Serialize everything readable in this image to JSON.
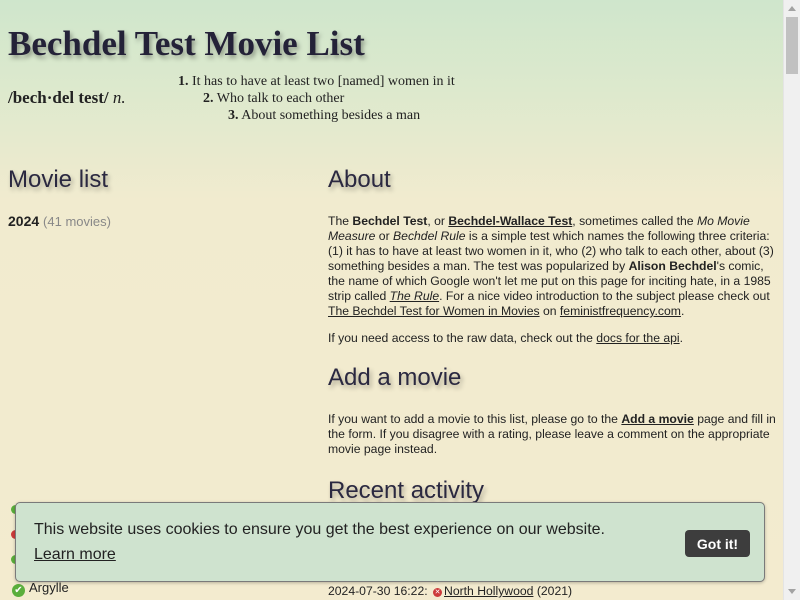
{
  "header": {
    "title": "Bechdel Test Movie List",
    "pronunciation": "/bech·del test/",
    "pos": "n.",
    "criteria": [
      {
        "num": "1.",
        "text": "It has to have at least two [named] women in it"
      },
      {
        "num": "2.",
        "text": "Who talk to each other"
      },
      {
        "num": "3.",
        "text": "About something besides a man"
      }
    ]
  },
  "movie_list": {
    "heading": "Movie list",
    "year": "2024",
    "count": "(41 movies)",
    "visible_item": "Argylle"
  },
  "about": {
    "heading": "About",
    "p1": {
      "t1": "The ",
      "b1": "Bechdel Test",
      "t2": ", or ",
      "link1": "Bechdel-Wallace Test",
      "t3": ", sometimes called the ",
      "i1": "Mo Movie Measure",
      "t4": " or ",
      "i2": "Bechdel Rule",
      "t5": " is a simple test which names the following three criteria: (1) it has to have at least two women in it, who (2) who talk to each other, about (3) something besides a man. The test was popularized by ",
      "b2": "Alison Bechdel",
      "t6": "'s comic, the name of which Google won't let me put on this page for inciting hate, in a 1985 strip called ",
      "link2": "The Rule",
      "t7": ". For a nice video introduction to the subject please check out ",
      "link3": "The Bechdel Test for Women in Movies",
      "t8": " on ",
      "link4": "feministfrequency.com",
      "t9": "."
    },
    "p2": {
      "t1": "If you need access to the raw data, check out the ",
      "link": "docs for the api",
      "t2": "."
    }
  },
  "add_movie": {
    "heading": "Add a movie",
    "t1": "If you want to add a movie to this list, please go to the ",
    "link": "Add a movie",
    "t2": " page and fill in the form. If you disagree with a rating, please leave a comment on the appropriate movie page instead."
  },
  "recent": {
    "heading": "Recent activity",
    "line_time": "2024-07-30 16:22:",
    "line_title": "North Hollywood",
    "line_year": "(2021)"
  },
  "cookie": {
    "message": "This website uses cookies to ensure you get the best experience on our website.",
    "learn_more": "Learn more",
    "button": "Got it!"
  },
  "colors": {
    "pass": "#5aae3c",
    "fail": "#cc3b3b",
    "cookie_bg": "#cfe3cf",
    "cookie_button": "#3d3d3d"
  },
  "icons": {
    "pass": "check-icon",
    "fail": "cross-icon"
  }
}
